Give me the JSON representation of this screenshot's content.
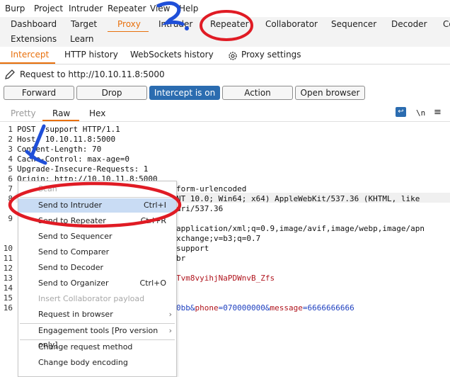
{
  "menubar": [
    "Burp",
    "Project",
    "Intruder",
    "Repeater",
    "View",
    "Help"
  ],
  "main_tabs_row1": [
    "Dashboard",
    "Target",
    "Proxy",
    "Intruder",
    "Repeater",
    "Collaborator",
    "Sequencer",
    "Decoder",
    "Co"
  ],
  "main_tabs_row2": [
    "Extensions",
    "Learn"
  ],
  "proxy_tabs": [
    "Intercept",
    "HTTP history",
    "WebSockets history",
    "Proxy settings"
  ],
  "request_label": "Request to http://10.10.11.8:5000",
  "buttons": {
    "forward": "Forward",
    "drop": "Drop",
    "intercept": "Intercept is on",
    "action": "Action",
    "open_browser": "Open browser"
  },
  "view_tabs": [
    "Pretty",
    "Raw",
    "Hex"
  ],
  "view_icons": {
    "wrap": "↩",
    "newline": "\\n",
    "menu": "≡"
  },
  "line_numbers": [
    "1",
    "2",
    "3",
    "4",
    "5",
    "6",
    "7",
    "8",
    "9",
    "10",
    "11",
    "12",
    "13",
    "14",
    "15",
    "16"
  ],
  "code_lines": [
    "POST /support HTTP/1.1",
    "Host: 10.10.11.8:5000",
    "Content-Length: 70",
    "Cache-Control: max-age=0",
    "Upgrade-Insecure-Requests: 1",
    "Origin: http://10.10.11.8:5000"
  ],
  "code_fragments": {
    "ct": "form-urlencoded",
    "ua1": "NT 10.0; Win64; x64) AppleWebKit/537.36 (KHTML, like",
    "ua2": "ari/537.36",
    "acc1": "application/xml;q=0.9,image/avif,image/webp,image/apn",
    "acc2": "xchange;v=b3;q=0.7",
    "ref": "support",
    "enc": "br",
    "cookie": "Tvm8vyihjNaPDWnvB_Zfs",
    "body_a": "0bb&",
    "body_p": "phone",
    "body_eq1": "=070000000&",
    "body_m": "message",
    "body_eq2": "=6666666666"
  },
  "context_menu": {
    "scan": "Scan",
    "items": [
      {
        "label": "Send to Intruder",
        "shortcut": "Ctrl+I"
      },
      {
        "label": "Send to Repeater",
        "shortcut": "Ctrl+R"
      },
      {
        "label": "Send to Sequencer",
        "shortcut": ""
      },
      {
        "label": "Send to Comparer",
        "shortcut": ""
      },
      {
        "label": "Send to Decoder",
        "shortcut": ""
      },
      {
        "label": "Send to Organizer",
        "shortcut": "Ctrl+O"
      },
      {
        "label": "Insert Collaborator payload",
        "shortcut": ""
      },
      {
        "label": "Request in browser",
        "shortcut": ""
      },
      {
        "label": "Engagement tools [Pro version only]",
        "shortcut": ""
      },
      {
        "label": "Change request method",
        "shortcut": ""
      },
      {
        "label": "Change body encoding",
        "shortcut": ""
      }
    ]
  },
  "annotations": {
    "step1": "1.",
    "step2": "2."
  },
  "colors": {
    "accent": "#e8700c",
    "selected": "#c9dcf4",
    "annotation_red": "#e01b24",
    "annotation_blue": "#1f4fd8",
    "param_red": "#b0151e",
    "param_blue": "#1d3fbf"
  }
}
